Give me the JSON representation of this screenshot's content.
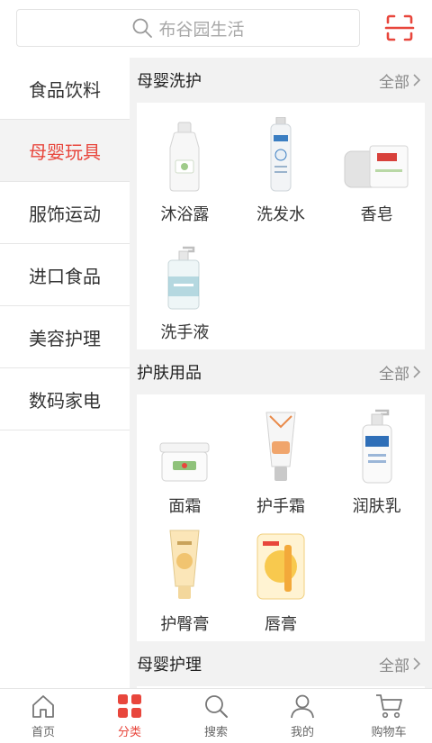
{
  "search": {
    "placeholder": "布谷园生活",
    "icon": "search-icon"
  },
  "scan": {
    "icon": "scan-icon",
    "color": "#e8463c"
  },
  "accent_color": "#e8463c",
  "sidebar": {
    "items": [
      {
        "label": "食品饮料"
      },
      {
        "label": "母婴玩具",
        "active": true
      },
      {
        "label": "服饰运动"
      },
      {
        "label": "进口食品"
      },
      {
        "label": "美容护理"
      },
      {
        "label": "数码家电"
      }
    ]
  },
  "sections": [
    {
      "title": "母婴洗护",
      "all_label": "全部",
      "products": [
        {
          "name": "沐浴露"
        },
        {
          "name": "洗发水"
        },
        {
          "name": "香皂"
        },
        {
          "name": "洗手液"
        }
      ]
    },
    {
      "title": "护肤用品",
      "all_label": "全部",
      "products": [
        {
          "name": "面霜"
        },
        {
          "name": "护手霜"
        },
        {
          "name": "润肤乳"
        },
        {
          "name": "护臀膏"
        },
        {
          "name": "唇膏"
        }
      ]
    },
    {
      "title": "母婴护理",
      "all_label": "全部",
      "products": []
    }
  ],
  "bottom_nav": [
    {
      "label": "首页",
      "icon": "home-icon"
    },
    {
      "label": "分类",
      "icon": "category-grid-icon",
      "active": true
    },
    {
      "label": "搜索",
      "icon": "search-icon"
    },
    {
      "label": "我的",
      "icon": "user-icon"
    },
    {
      "label": "购物车",
      "icon": "cart-icon"
    }
  ]
}
